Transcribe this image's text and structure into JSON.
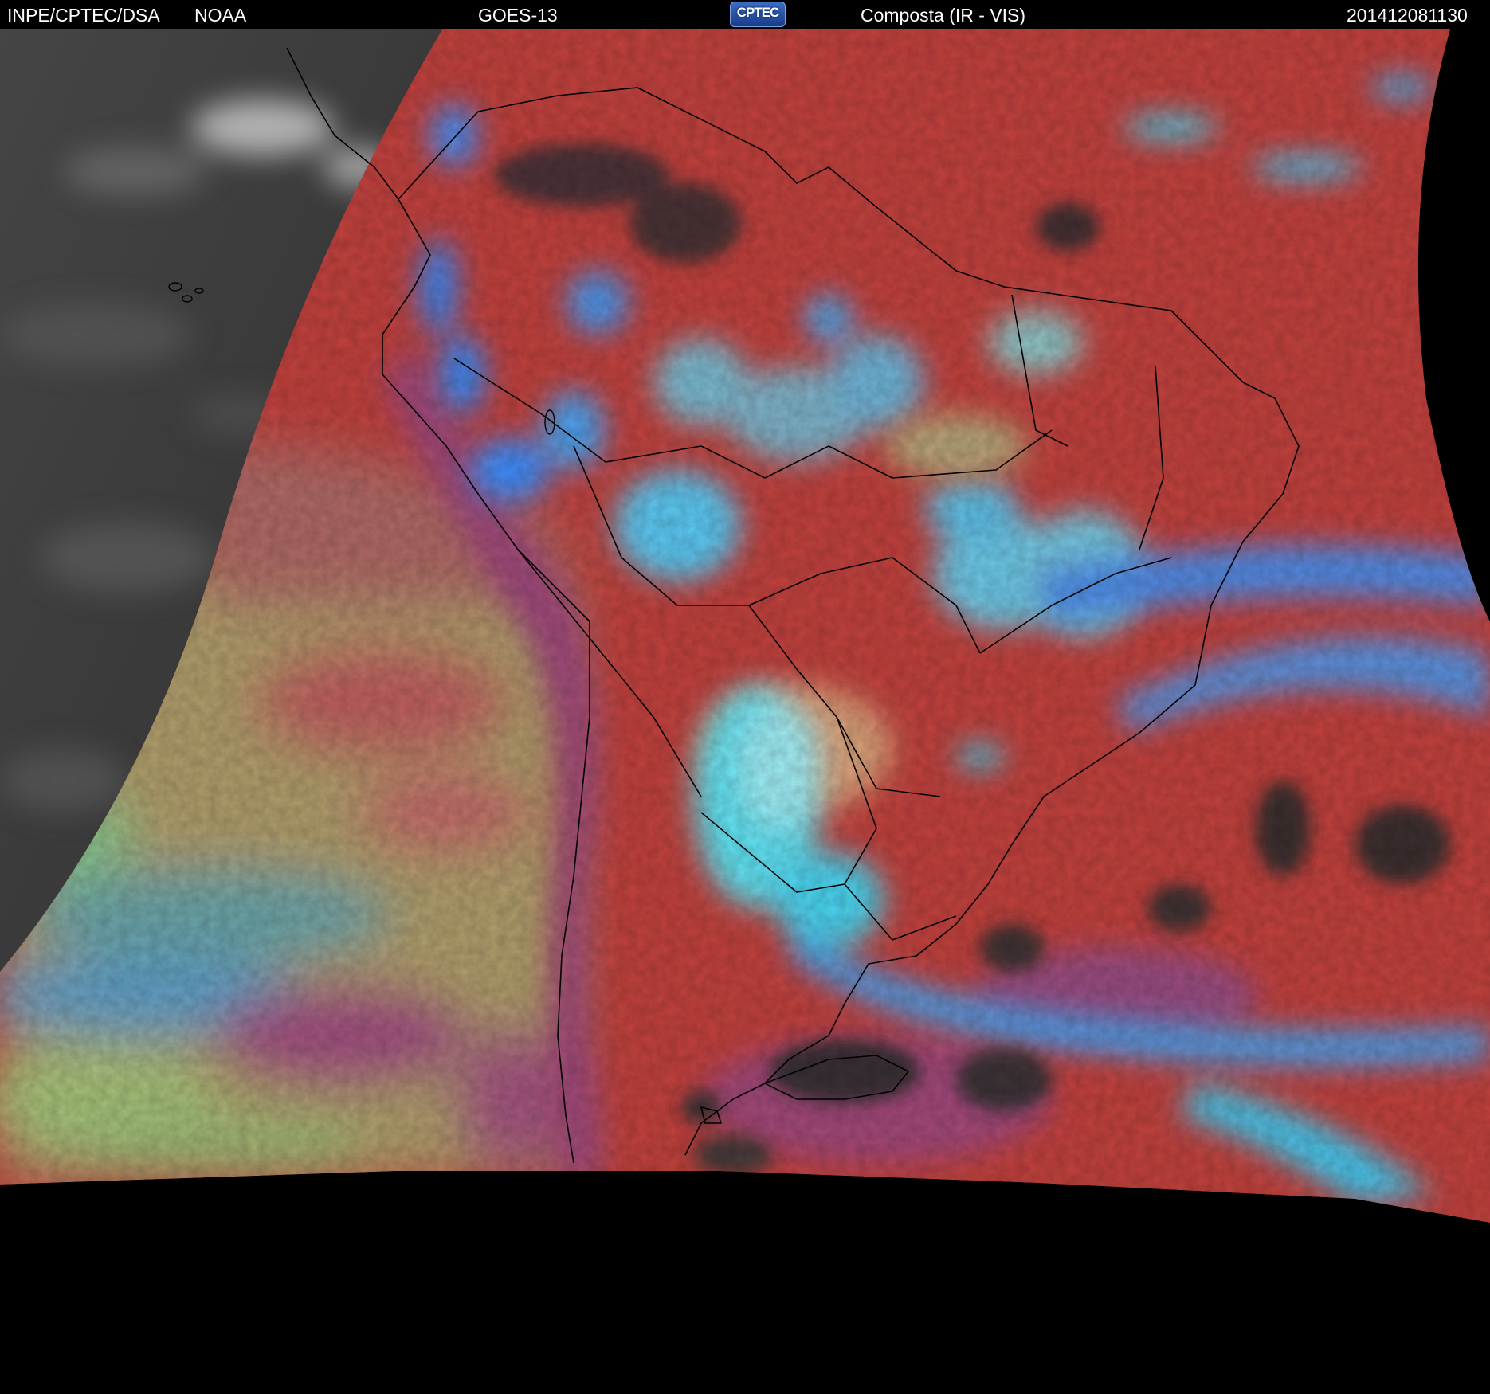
{
  "header": {
    "organization": "INPE/CPTEC/DSA",
    "agency": "NOAA",
    "satellite": "GOES-13",
    "logo_text": "CPTEC",
    "product": "Composta (IR - VIS)",
    "timestamp": "201412081130"
  },
  "colors": {
    "background": "#000000",
    "header_text": "#ffffff",
    "visible_ocean_gray": "#3a3a3a",
    "composite_red": "#c8413f",
    "composite_magenta": "#a3447a",
    "composite_khaki": "#b3a06a",
    "cloud_cyan": "#49dcf2",
    "cloud_blue": "#3f8fff",
    "coastline": "#000000"
  },
  "icons": {
    "logo": "cptec-logo-icon"
  }
}
